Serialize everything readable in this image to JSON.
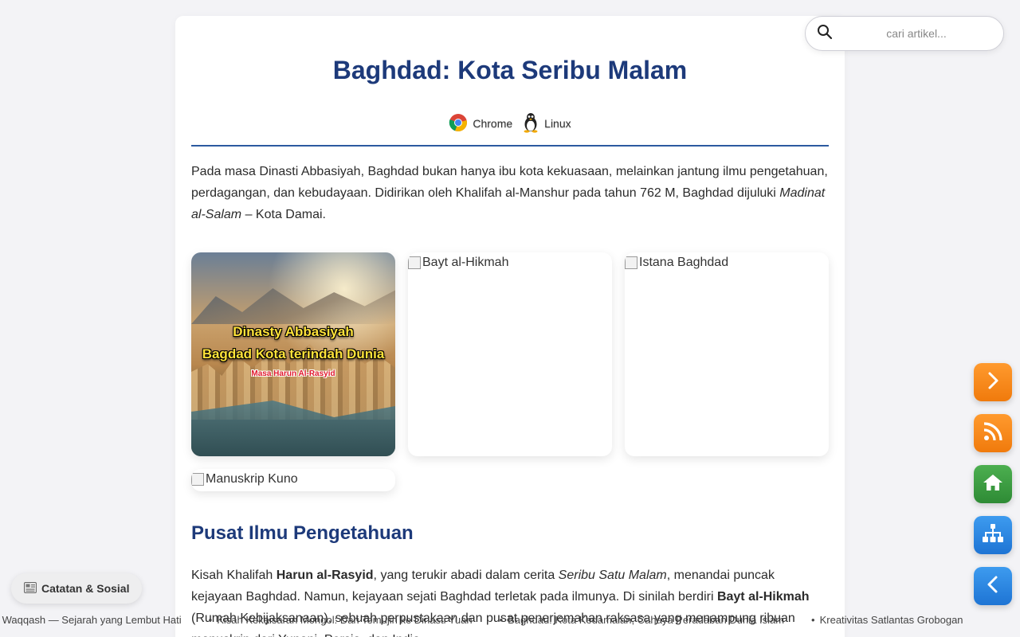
{
  "article": {
    "title": "Baghdad: Kota Seribu Malam",
    "platforms": [
      {
        "label": "Chrome",
        "icon": "chrome-icon"
      },
      {
        "label": "Linux",
        "icon": "linux-tux-icon"
      }
    ],
    "intro": {
      "part1": "Pada masa Dinasti Abbasiyah, Baghdad bukan hanya ibu kota kekuasaan, melainkan jantung ilmu pengetahuan, perdagangan, dan kebudayaan. Didirikan oleh Khalifah al-Manshur pada tahun 762 M, Baghdad dijuluki ",
      "emphasis": "Madinat al-Salam",
      "part2": " – Kota Damai."
    },
    "gallery": [
      {
        "alt": "Dinasty Abbasiyah",
        "caption_line1": "Dinasty Abbasiyah",
        "caption_line2": "Bagdad Kota terindah Dunia",
        "caption_line3": "Masa Harun Al-Rasyid",
        "loaded": true
      },
      {
        "alt": "Bayt al-Hikmah",
        "loaded": false
      },
      {
        "alt": "Istana Baghdad",
        "loaded": false
      },
      {
        "alt": "Manuskrip Kuno",
        "loaded": false
      }
    ],
    "section_heading": "Pusat Ilmu Pengetahuan",
    "section_para": {
      "t1": "Kisah Khalifah ",
      "b1": "Harun al-Rasyid",
      "t2": ", yang terukir abadi dalam cerita ",
      "i1": "Seribu Satu Malam",
      "t3": ", menandai puncak kejayaan Baghdad. Namun, kejayaan sejati Baghdad terletak pada ilmunya. Di sinilah berdiri ",
      "b2": "Bayt al-Hikmah",
      "t4": " (Rumah Kebijaksanaan), sebuah perpustakaan dan pusat penerjemahan raksasa yang menampung ribuan manuskrip dari Yunani, Persia, dan India."
    }
  },
  "search": {
    "placeholder": "cari artikel..."
  },
  "floating_buttons": [
    {
      "name": "next-button",
      "icon": "chevron-right-icon",
      "color": "#f58a1f"
    },
    {
      "name": "rss-button",
      "icon": "rss-icon",
      "color": "#f58a1f"
    },
    {
      "name": "home-button",
      "icon": "home-icon",
      "color": "#3fa34d"
    },
    {
      "name": "sitemap-button",
      "icon": "sitemap-icon",
      "color": "#2b86e0"
    },
    {
      "name": "back-button",
      "icon": "chevron-left-icon",
      "color": "#2b86e0"
    }
  ],
  "notes_button": {
    "icon": "newspaper-icon",
    "label": "Catatan & Sosial"
  },
  "ticker": [
    "bin Abi Waqqash — Sejarah yang Lembut Hati",
    "Kisah Kekaisaran Mongol: Dari Temujin ke Dinasti Yuan",
    "Baghdad: Kota Kedamaian, Cahaya Peradaban Dunia Islam",
    "Kreativitas Satlantas Grobogan"
  ],
  "colors": {
    "heading": "#1d3a7a",
    "rule": "#2c5aa0",
    "orange": "#f58a1f",
    "green": "#3fa34d",
    "blue": "#2b86e0"
  }
}
